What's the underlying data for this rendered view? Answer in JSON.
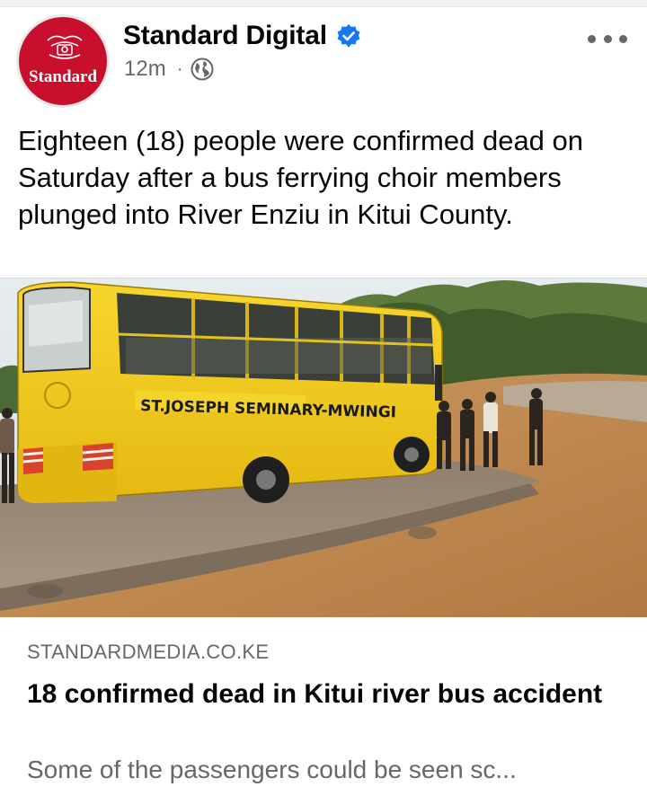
{
  "post": {
    "page_name": "Standard Digital",
    "avatar_text": "Standard",
    "timestamp": "12m",
    "separator": "·",
    "audience_icon": "globe-icon",
    "verified_icon": "verified-badge-icon",
    "more_icon": "more-options-icon",
    "caption": "Eighteen (18) people were confirmed dead on Saturday after a bus ferrying choir members plunged into River Enziu in Kitui County."
  },
  "photo": {
    "bus_sign": "ST.JOSEPH SEMINARY-MWINGI"
  },
  "link_preview": {
    "domain": "STANDARDMEDIA.CO.KE",
    "title": "18 confirmed dead in Kitui river bus accident",
    "description": "Some of the passengers could be seen sc..."
  },
  "colors": {
    "brand_red": "#c8102e",
    "verified_blue": "#1877f2",
    "secondary_text": "#65676b",
    "bus_yellow": "#f2cf1c"
  }
}
